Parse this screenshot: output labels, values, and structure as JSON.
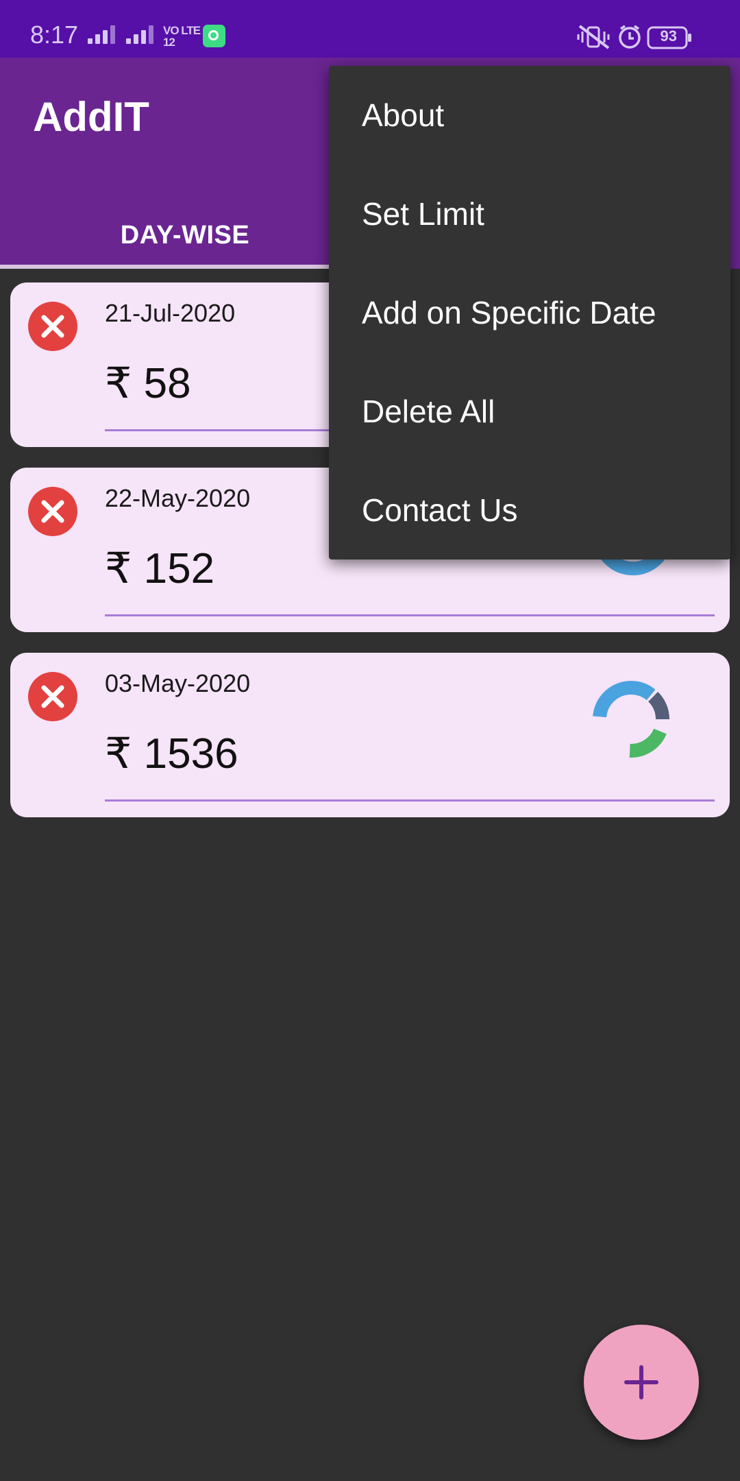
{
  "status_bar": {
    "time": "8:17",
    "network": "VO LTE",
    "sim_1": "1",
    "sim_2": "2",
    "battery": "93"
  },
  "app": {
    "title": "AddIT"
  },
  "tabs": [
    {
      "label": "DAY-WISE",
      "selected": true
    }
  ],
  "entries": [
    {
      "date": "21-Jul-2020",
      "amount": "₹ 58"
    },
    {
      "date": "22-May-2020",
      "amount": "₹ 152"
    },
    {
      "date": "03-May-2020",
      "amount": "₹ 1536"
    }
  ],
  "menu": {
    "items": [
      {
        "label": "About"
      },
      {
        "label": "Set Limit"
      },
      {
        "label": "Add on Specific Date"
      },
      {
        "label": "Delete All"
      },
      {
        "label": "Contact Us"
      }
    ]
  },
  "fab": {
    "icon": "plus-icon"
  },
  "colors": {
    "status_bar": "#5610a8",
    "app_bar": "#6a2591",
    "background": "#303030",
    "card": "#f6e4f8",
    "delete": "#e34040",
    "menu": "#333333",
    "fab": "#f0a3c1",
    "fab_icon": "#6a2591"
  }
}
